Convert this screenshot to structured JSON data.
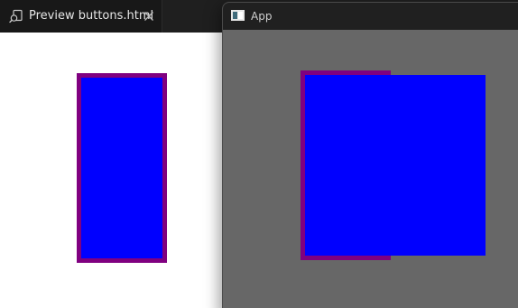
{
  "editor": {
    "tab": {
      "label": "Preview buttons.html",
      "icon": "preview-icon",
      "close_icon": "close-icon"
    },
    "preview_button": {
      "border_color": "#800080",
      "fill_color": "#0000ff"
    }
  },
  "app_window": {
    "title": "App",
    "icon": "window-icon",
    "background": "#676767",
    "button": {
      "border_color": "#800080",
      "fill_color": "#0000ff"
    }
  }
}
